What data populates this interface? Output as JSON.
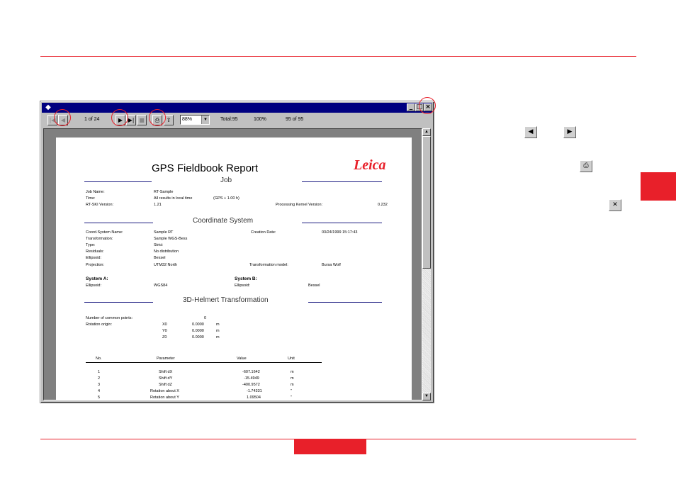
{
  "viewer": {
    "toolbar": {
      "first_icon": "first-page-icon",
      "prev_icon": "previous-page-icon",
      "page_indicator": "1 of 24",
      "next_icon": "next-page-icon",
      "last_icon": "last-page-icon",
      "stop_icon": "stop-icon",
      "print_icon": "print-icon",
      "export_icon": "export-icon",
      "zoom": "88%",
      "total": "Total:95",
      "percent": "100%",
      "count": "95 of 95"
    },
    "title_buttons": [
      "_",
      "□",
      "×"
    ]
  },
  "report": {
    "title": "GPS Fieldbook Report",
    "logo": "Leica",
    "job_section": "Job",
    "job": [
      [
        "Job Name:",
        "RT-Sample"
      ],
      [
        "Time:",
        "All results in local time",
        "(GPS + 1.00 h)"
      ],
      [
        "RT-SKI Version:",
        "1.21",
        "Processing Kernel Version:",
        "0.232"
      ]
    ],
    "coord_section": "Coordinate System",
    "coord": [
      [
        "Coord.System Name:",
        "Sample RT",
        "Creation Date:",
        "03/24/1999 15:17:43"
      ],
      [
        "Transformation:",
        "Sample WGS-Bess"
      ],
      [
        "Type:",
        "Strict"
      ],
      [
        "Residuals:",
        "No distribution"
      ],
      [
        "Ellipsoid:",
        "Bessel"
      ],
      [
        "Projection:",
        "UTM32 North",
        "Transformation model:",
        "Bursa Wolf"
      ]
    ],
    "system_a": "System A:",
    "system_b": "System B:",
    "ellipsoid_a_label": "Ellipsoid:",
    "ellipsoid_a": "WGS84",
    "ellipsoid_b_label": "Ellipsoid:",
    "ellipsoid_b": "Bessel",
    "helmert_section": "3D-Helmert Transformation",
    "common_points_label": "Number of common points:",
    "common_points": "0",
    "rotation_origin_label": "Rotation origin:",
    "origin": [
      [
        "X0",
        "0.0000",
        "m"
      ],
      [
        "Y0",
        "0.0000",
        "m"
      ],
      [
        "Z0",
        "0.0000",
        "m"
      ]
    ],
    "param_headers": [
      "No.",
      "Parameter",
      "Value",
      "Unit"
    ],
    "params": [
      [
        "1",
        "Shift dX",
        "-607.1642",
        "m"
      ],
      [
        "2",
        "Shift dY",
        "-15.4949",
        "m"
      ],
      [
        "3",
        "Shift dZ",
        "-400.9572",
        "m"
      ],
      [
        "4",
        "Rotation about X",
        "-1.74331",
        "\""
      ],
      [
        "5",
        "Rotation about Y",
        "1.09504",
        "\""
      ]
    ]
  },
  "side_icons": {
    "prev": "previous-page-icon",
    "next": "next-page-icon",
    "print": "print-icon",
    "close": "close-icon"
  },
  "colors": {
    "accent": "#e8202a",
    "titlebar": "#000080"
  }
}
